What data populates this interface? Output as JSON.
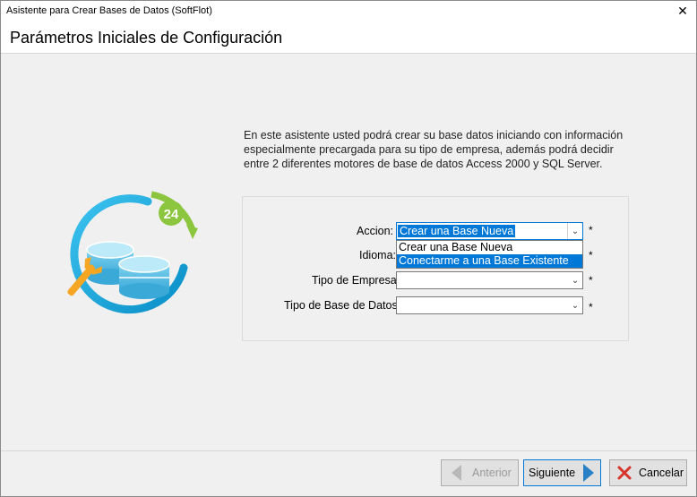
{
  "window": {
    "title": "Asistente para Crear Bases de Datos (SoftFlot)",
    "close_glyph": "✕"
  },
  "header": {
    "title": "Parámetros Iniciales de Configuración"
  },
  "logo": {
    "badge_number": "24",
    "icon": "database-wrench-icon"
  },
  "description": "En este asistente usted podrá crear su base datos iniciando con información especialmente precargada para su tipo de empresa, además podrá decidir entre 2 diferentes motores de base de datos Access 2000 y SQL Server.",
  "form": {
    "required_mark": "*",
    "fields": [
      {
        "label": "Accion:",
        "value": "Crear una Base Nueva"
      },
      {
        "label": "Idioma:",
        "value": ""
      },
      {
        "label": "Tipo de Empresa:",
        "value": ""
      },
      {
        "label": "Tipo de Base de Datos:",
        "value": ""
      }
    ],
    "dropdown_options": [
      "Crear una Base Nueva",
      "Conectarme a una Base Existente"
    ],
    "highlighted_option": "Conectarme a una Base Existente"
  },
  "buttons": {
    "back": "Anterior",
    "next": "Siguiente",
    "cancel": "Cancelar"
  },
  "colors": {
    "accent": "#0078d7",
    "logo_blue": "#1aa3d6",
    "logo_green": "#8cc63f",
    "wrench": "#f5a623"
  }
}
